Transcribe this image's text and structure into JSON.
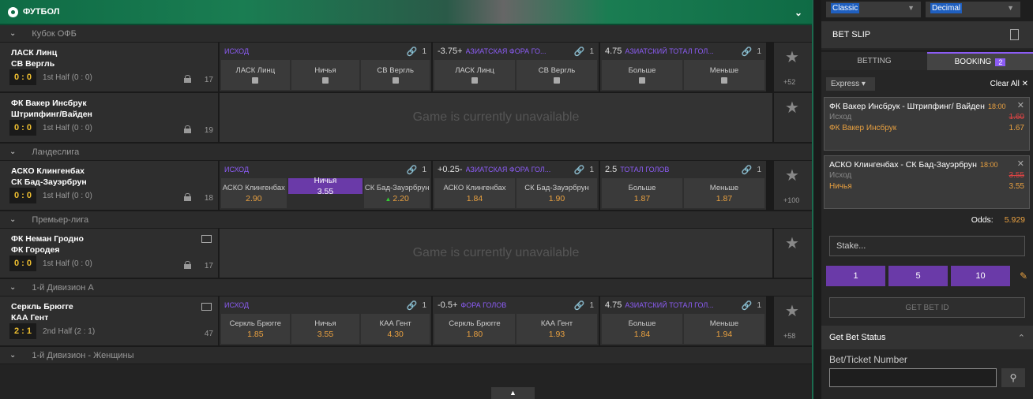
{
  "sport": {
    "title": "ФУТБОЛ"
  },
  "leagues": [
    {
      "name": "Кубок ОФБ"
    },
    {
      "name": "Ландеслига"
    },
    {
      "name": "Премьер-лига"
    },
    {
      "name": "1-й Дивизион A"
    },
    {
      "name": "1-й Дивизион - Женщины"
    }
  ],
  "matches": [
    {
      "team1": "ЛАСК Линц",
      "team2": "СВ Вергль",
      "score": "0 : 0",
      "half": "1st Half",
      "sub": "(0 : 0)",
      "count": "17",
      "more": "+52",
      "m1": {
        "name": "ИСХОД",
        "n": "1",
        "o": [
          {
            "l": "ЛАСК Линц"
          },
          {
            "l": "Ничья"
          },
          {
            "l": "СВ Вергль"
          }
        ]
      },
      "m2": {
        "line": "-3.75+",
        "name": "АЗИАТСКАЯ ФОРА ГО...",
        "n": "1",
        "o": [
          {
            "l": "ЛАСК Линц"
          },
          {
            "l": "СВ Вергль"
          }
        ]
      },
      "m3": {
        "line": "4.75",
        "name": "АЗИАТСКИЙ ТОТАЛ ГОЛ...",
        "n": "1",
        "o": [
          {
            "l": "Больше"
          },
          {
            "l": "Меньше"
          }
        ]
      }
    },
    {
      "team1": "ФК Вакер Инсбрук",
      "team2": "Штрипфинг/Вайден",
      "score": "0 : 0",
      "half": "1st Half",
      "sub": "(0 : 0)",
      "count": "19",
      "unavailable": "Game is currently unavailable"
    },
    {
      "team1": "АСКО Клингенбах",
      "team2": "СК Бад-Зауэрбрун",
      "score": "0 : 0",
      "half": "1st Half",
      "sub": "(0 : 0)",
      "count": "18",
      "more": "+100",
      "m1": {
        "name": "ИСХОД",
        "n": "1",
        "o": [
          {
            "l": "АСКО Клингенбах",
            "v": "2.90"
          },
          {
            "l": "Ничья",
            "v": "3.55"
          },
          {
            "l": "СК Бад-Зауэрбрун",
            "v": "2.20"
          }
        ]
      },
      "m2": {
        "line": "+0.25-",
        "name": "АЗИАТСКАЯ ФОРА ГОЛ...",
        "n": "1",
        "o": [
          {
            "l": "АСКО Клингенбах",
            "v": "1.84"
          },
          {
            "l": "СК Бад-Зауэрбрун",
            "v": "1.90"
          }
        ]
      },
      "m3": {
        "line": "2.5",
        "name": "ТОТАЛ ГОЛОВ",
        "n": "1",
        "o": [
          {
            "l": "Больше",
            "v": "1.87"
          },
          {
            "l": "Меньше",
            "v": "1.87"
          }
        ]
      }
    },
    {
      "team1": "ФК Неман Гродно",
      "team2": "ФК Городея",
      "score": "0 : 0",
      "half": "1st Half",
      "sub": "(0 : 0)",
      "count": "17",
      "unavailable": "Game is currently unavailable"
    },
    {
      "team1": "Серкль Брюгге",
      "team2": "КАА Гент",
      "score": "2 : 1",
      "half": "2nd Half",
      "sub": "(2 : 1)",
      "count": "47",
      "more": "+58",
      "m1": {
        "name": "ИСХОД",
        "n": "1",
        "o": [
          {
            "l": "Серкль Брюгге",
            "v": "1.85"
          },
          {
            "l": "Ничья",
            "v": "3.55"
          },
          {
            "l": "КАА Гент",
            "v": "4.30"
          }
        ]
      },
      "m2": {
        "line": "-0.5+",
        "name": "ФОРА ГОЛОВ",
        "n": "1",
        "o": [
          {
            "l": "Серкль Брюгге",
            "v": "1.80"
          },
          {
            "l": "КАА Гент",
            "v": "1.93"
          }
        ]
      },
      "m3": {
        "line": "4.75",
        "name": "АЗИАТСКИЙ ТОТАЛ ГОЛ...",
        "n": "1",
        "o": [
          {
            "l": "Больше",
            "v": "1.84"
          },
          {
            "l": "Меньше",
            "v": "1.94"
          }
        ]
      }
    }
  ],
  "right": {
    "select1": "Classic",
    "select2": "Decimal",
    "betslip": "BET SLIP",
    "tab_betting": "BETTING",
    "tab_booking": "BOOKING",
    "booking_count": "2",
    "express": "Express",
    "clear_all": "Clear All",
    "slips": [
      {
        "title": "ФК Вакер Инсбрук - Штрипфинг/ Вайден",
        "time": "18:00",
        "label": "Исход",
        "old": "1.60",
        "pick": "ФК Вакер Инсбрук",
        "value": "1.67"
      },
      {
        "title": "АСКО Клингенбах - СК Бад-Зауэрбрун",
        "time": "18:00",
        "label": "Исход",
        "old": "3.55",
        "pick": "Ничья",
        "value": "3.55"
      }
    ],
    "odds_label": "Odds:",
    "odds_value": "5.929",
    "stake_placeholder": "Stake...",
    "quick": [
      "1",
      "5",
      "10"
    ],
    "get_bet_id": "GET BET ID",
    "get_bet_status": "Get Bet Status",
    "ticket_label": "Bet/Ticket Number"
  }
}
